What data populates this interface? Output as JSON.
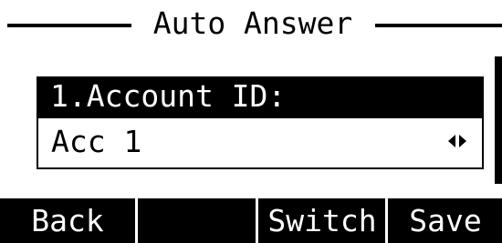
{
  "title": "Auto Answer",
  "list": {
    "selected_item": {
      "label": "1.Account ID:",
      "value": "Acc 1",
      "arrows_icon": "left-right-arrows-icon"
    }
  },
  "softkeys": {
    "back": "Back",
    "empty": "",
    "switch": "Switch",
    "save": "Save"
  },
  "colors": {
    "foreground": "#000000",
    "background": "#ffffff"
  }
}
